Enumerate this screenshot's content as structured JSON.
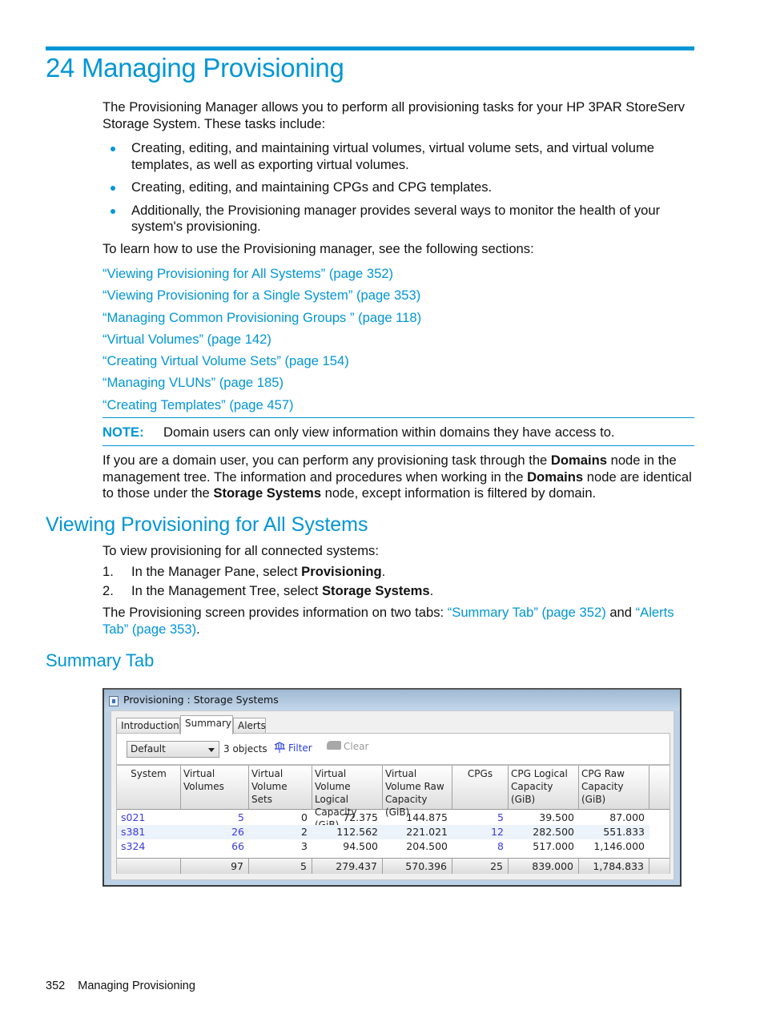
{
  "chapter": {
    "title": "24 Managing Provisioning"
  },
  "intro": {
    "paragraph": "The Provisioning Manager allows you to perform all provisioning tasks for your HP 3PAR StoreServ Storage System. These tasks include:",
    "bullets": [
      "Creating, editing, and maintaining virtual volumes, virtual volume sets, and virtual volume templates, as well as exporting virtual volumes.",
      "Creating, editing, and maintaining CPGs and CPG templates.",
      "Additionally, the Provisioning manager provides several ways to monitor the health of your system's provisioning."
    ],
    "learn_text": "To learn how to use the Provisioning manager, see the following sections:",
    "links": [
      "“Viewing Provisioning for All Systems” (page 352)",
      "“Viewing Provisioning for a Single System” (page 353)",
      "“Managing Common Provisioning Groups ” (page 118)",
      "“Virtual Volumes” (page 142)",
      "“Creating Virtual Volume Sets” (page 154)",
      "“Managing VLUNs” (page 185)",
      "“Creating Templates” (page 457)"
    ]
  },
  "note": {
    "label": "NOTE:",
    "text": "Domain users can only view information within domains they have access to."
  },
  "domain_paragraph": {
    "part1": "If you are a domain user, you can perform any provisioning task through the ",
    "bold1": "Domains",
    "part2": " node in the management tree. The information and procedures when working in the ",
    "bold2": "Domains",
    "part3": " node are identical to those under the ",
    "bold3": "Storage Systems",
    "part4": " node, except information is filtered by domain."
  },
  "section_all_systems": {
    "heading": "Viewing Provisioning for All Systems",
    "lead": "To view provisioning for all connected systems:",
    "steps": [
      {
        "num": "1.",
        "text": "In the Manager Pane, select ",
        "bold": "Provisioning",
        "end": "."
      },
      {
        "num": "2.",
        "text": "In the Management Tree, select ",
        "bold": "Storage Systems",
        "end": "."
      }
    ],
    "tabs_text_1": "The Provisioning screen provides information on two tabs: ",
    "tabs_link_1": "“Summary Tab” (page 352)",
    "tabs_text_2": " and ",
    "tabs_link_2": "“Alerts Tab” (page 353)",
    "tabs_text_3": "."
  },
  "section_summary": {
    "heading": "Summary Tab"
  },
  "window": {
    "title": "Provisioning : Storage Systems",
    "tabs": [
      "Introduction",
      "Summary",
      "Alerts"
    ],
    "active_tab": "Summary",
    "view_select": "Default",
    "object_count": "3 objects",
    "filter_label": "Filter",
    "clear_label": "Clear",
    "columns": [
      "System",
      "Virtual Volumes",
      "Virtual Volume Sets",
      "Virtual Volume Logical Capacity (GiB)",
      "Virtual Volume Raw Capacity (GiB)",
      "CPGs",
      "CPG Logical Capacity (GiB)",
      "CPG Raw Capacity (GiB)"
    ],
    "rows": [
      [
        "s021",
        "5",
        "0",
        "72.375",
        "144.875",
        "5",
        "39.500",
        "87.000"
      ],
      [
        "s381",
        "26",
        "2",
        "112.562",
        "221.021",
        "12",
        "282.500",
        "551.833"
      ],
      [
        "s324",
        "66",
        "3",
        "94.500",
        "204.500",
        "8",
        "517.000",
        "1,146.000"
      ]
    ],
    "totals": [
      "",
      "97",
      "5",
      "279.437",
      "570.396",
      "25",
      "839.000",
      "1,784.833"
    ]
  },
  "footer": {
    "page_number": "352",
    "section": "Managing Provisioning"
  }
}
